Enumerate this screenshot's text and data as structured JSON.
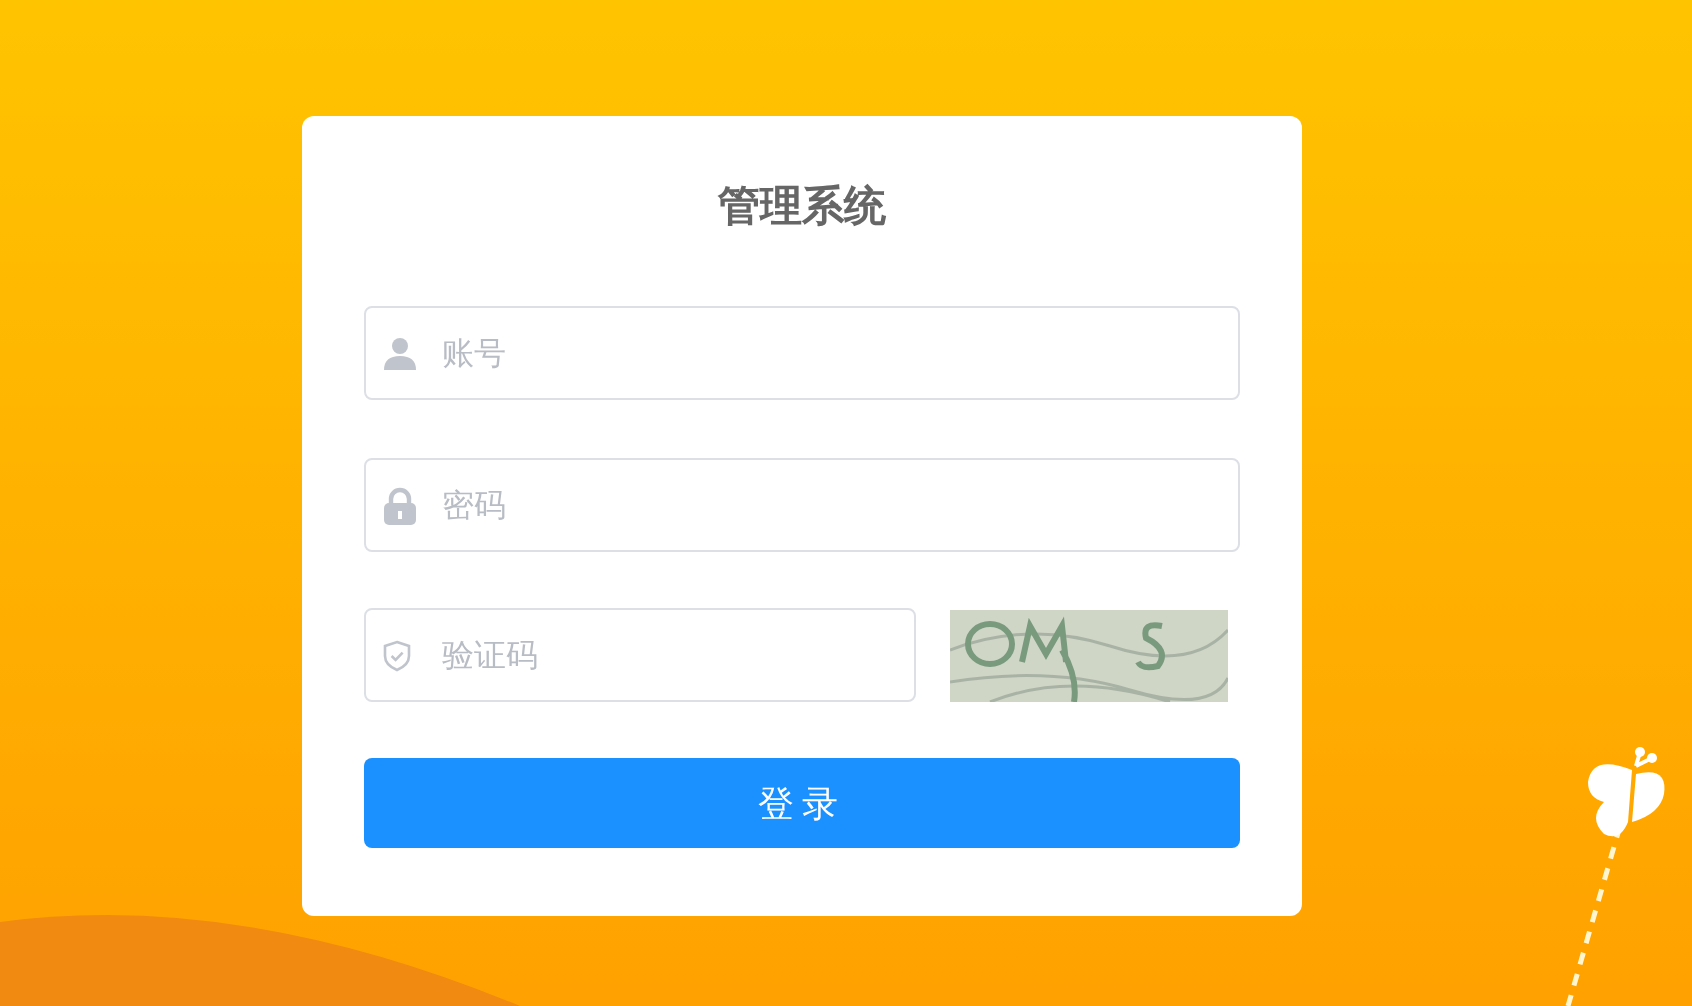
{
  "title": "管理系统",
  "fields": [
    {
      "kind": "user",
      "placeholder": "账号"
    },
    {
      "kind": "lock",
      "placeholder": "密码"
    },
    {
      "kind": "shield",
      "placeholder": "验证码"
    }
  ],
  "login_button": "登录"
}
